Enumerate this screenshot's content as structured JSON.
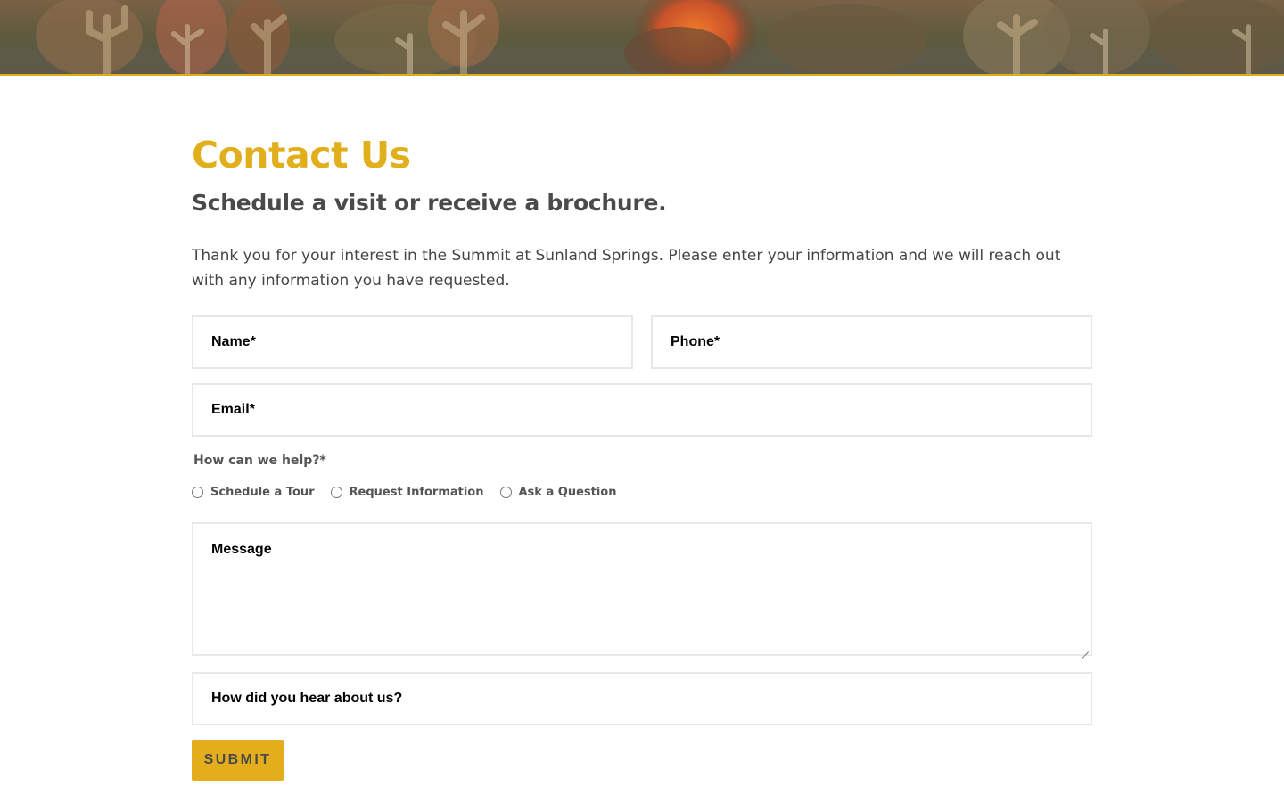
{
  "hero": {
    "image": "desert-cactus-banner",
    "accent_color": "#e0ad1a"
  },
  "page": {
    "title": "Contact Us",
    "subtitle": "Schedule a visit or receive a brochure.",
    "intro": "Thank you for your interest in the Summit at Sunland Springs. Please enter your information and we will reach out with any information you have requested."
  },
  "form": {
    "name_placeholder": "Name*",
    "phone_placeholder": "Phone*",
    "email_placeholder": "Email*",
    "help_label": "How can we help?*",
    "options": [
      "Schedule a Tour",
      "Request Information",
      "Ask a Question"
    ],
    "message_placeholder": "Message",
    "referral_placeholder": "How did you hear about us?",
    "submit_label": "SUBMIT"
  },
  "colors": {
    "title": "#e2af1c",
    "button": "#e3ad1b",
    "text": "#454545"
  }
}
